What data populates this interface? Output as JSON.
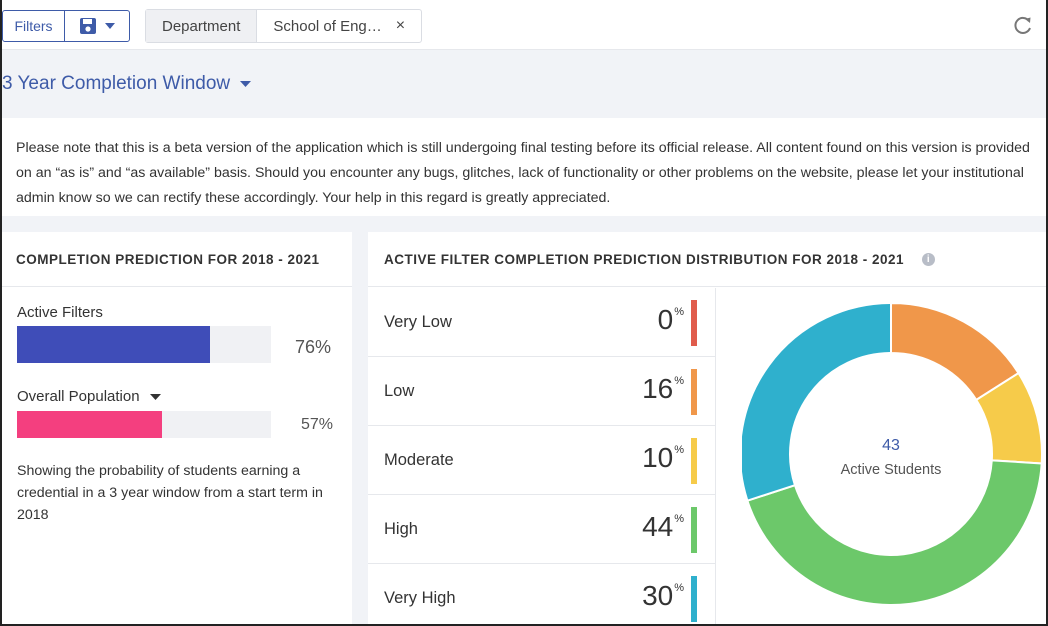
{
  "toolbar": {
    "filters_label": "Filters",
    "save_icon": "floppy-disk-icon",
    "chip_key": "Department",
    "chip_value": "School of Eng…",
    "chip_close": "×"
  },
  "window_title": "3 Year Completion Window",
  "notice": "Please note that this is a beta version of the application which is still undergoing final testing before its official release. All content found on this version is provided on an “as is” and “as available” basis. Should you encounter any bugs, glitches, lack of functionality or other problems on the website, please let your institutional admin know so we can rectify these accordingly. Your help in this regard is greatly appreciated.",
  "left_panel": {
    "title": "COMPLETION PREDICTION FOR 2018 - 2021",
    "bars": [
      {
        "label": "Active Filters",
        "value": 76,
        "value_text": "76%",
        "color": "#3f4db8"
      },
      {
        "label": "Overall Population",
        "value": 57,
        "value_text": "57%",
        "color": "#f43f7f"
      }
    ],
    "description": "Showing the probability of students earning a credential in a 3 year window from a start term in 2018"
  },
  "right_panel": {
    "title": "ACTIVE FILTER COMPLETION PREDICTION DISTRIBUTION FOR 2018 - 2021",
    "rows": [
      {
        "label": "Very Low",
        "value": "0",
        "color": "#e05c4c"
      },
      {
        "label": "Low",
        "value": "16",
        "color": "#f0974a"
      },
      {
        "label": "Moderate",
        "value": "10",
        "color": "#f6cb4a"
      },
      {
        "label": "High",
        "value": "44",
        "color": "#6cc86a"
      },
      {
        "label": "Very High",
        "value": "30",
        "color": "#2fb0cd"
      }
    ],
    "pct_symbol": "%",
    "center_count": "43",
    "center_label": "Active Students"
  }
}
